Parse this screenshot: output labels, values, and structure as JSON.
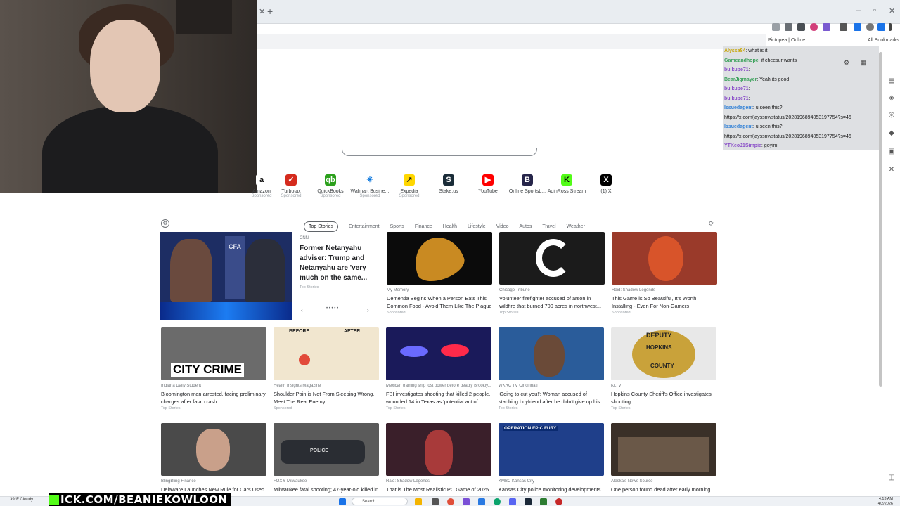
{
  "overlay": {
    "kick_url": "ICK.COM/BEANIEKOWLOON"
  },
  "chat": {
    "messages": [
      {
        "user": "Alyssa84",
        "user_color": "#c7a400",
        "text": ": what is it"
      },
      {
        "user": "Gameandhope",
        "user_color": "#3aa15a",
        "text": ": if cheesur wants"
      },
      {
        "user": "bulkupe71",
        "user_color": "#8a4fc8",
        "text": ": "
      },
      {
        "user": "BearJigmayer",
        "user_color": "#3aa15a",
        "text": ": Yeah its good"
      },
      {
        "user": "bulkupe71",
        "user_color": "#8a4fc8",
        "text": ": "
      },
      {
        "user": "bulkupe71",
        "user_color": "#8a4fc8",
        "text": ": "
      },
      {
        "user": "Issuedagent",
        "user_color": "#2f7fd6",
        "text": ": u seen this?"
      },
      {
        "user": "",
        "user_color": "#1a1a1a",
        "text": "https://x.com/jayssnv/status/2028196894053197754?s=46"
      },
      {
        "user": "Issuedagent",
        "user_color": "#2f7fd6",
        "text": ": u seen this?"
      },
      {
        "user": "",
        "user_color": "#1a1a1a",
        "text": "https://x.com/jayssnv/status/2028196894053197754?s=46"
      },
      {
        "user": "YTKeoJ1Simpie",
        "user_color": "#8a4fc8",
        "text": ": goyimi"
      }
    ]
  },
  "bookmarks": {
    "item1": "Pictopea | Online...",
    "item2": "All Bookmarks"
  },
  "shortcuts": [
    {
      "label": "Amazon",
      "sponsored": "Sponsored",
      "icon": "a",
      "color": "#111111",
      "bg": "#ffffff"
    },
    {
      "label": "Turbotax",
      "sponsored": "Sponsored",
      "icon": "✓",
      "color": "#ffffff",
      "bg": "#d52b1e"
    },
    {
      "label": "QuickBooks",
      "sponsored": "Sponsored",
      "icon": "qb",
      "color": "#ffffff",
      "bg": "#2ca01c"
    },
    {
      "label": "Walmart Busine...",
      "sponsored": "Sponsored",
      "icon": "✳",
      "color": "#0071dc",
      "bg": "#ffffff"
    },
    {
      "label": "Expedia",
      "sponsored": "Sponsored",
      "icon": "↗",
      "color": "#1a1a1a",
      "bg": "#ffd700"
    },
    {
      "label": "Stake.us",
      "sponsored": "",
      "icon": "S",
      "color": "#ffffff",
      "bg": "#1a2c38"
    },
    {
      "label": "YouTube",
      "sponsored": "",
      "icon": "▶",
      "color": "#ffffff",
      "bg": "#ff0000"
    },
    {
      "label": "Online Sportsb...",
      "sponsored": "",
      "icon": "B",
      "color": "#ffffff",
      "bg": "#26254a"
    },
    {
      "label": "AdinRoss Stream",
      "sponsored": "",
      "icon": "K",
      "color": "#000000",
      "bg": "#53fc18"
    },
    {
      "label": "(1) X",
      "sponsored": "",
      "icon": "X",
      "color": "#ffffff",
      "bg": "#000000"
    }
  ],
  "feed": {
    "tabs": [
      "Top Stories",
      "Entertainment",
      "Sports",
      "Finance",
      "Health",
      "Lifestyle",
      "Video",
      "Autos",
      "Travel",
      "Weather"
    ],
    "hero": {
      "source": "CNN",
      "title": "Former Netanyahu adviser: Trump and Netanyahu are 'very much on the same...",
      "tag": "Top Stories",
      "logo": "CFA",
      "dots": "• • • • •"
    },
    "row1": [
      {
        "source": "My Memory",
        "title": "Dementia Begins When a Person Eats This Common Food - Avoid Them Like The Plague",
        "tag": "Sponsored",
        "bg": "#0b0b0b"
      },
      {
        "source": "Chicago Tribune",
        "title": "Volunteer firefighter accused of arson in wildfire that burned 700 acres in northwest...",
        "tag": "Top Stories",
        "bg": "#1b1b1b"
      },
      {
        "source": "Raid: Shadow Legends",
        "title": "This Game is So Beautiful, It's Worth Installing - Even For Non-Gamers",
        "tag": "Sponsored",
        "bg": "#9a3a2a"
      }
    ],
    "row2": [
      {
        "source": "Indiana Daily Student",
        "title": "Bloomington man arrested, facing preliminary charges after fatal crash",
        "tag": "Top Stories",
        "bg": "#6b6b6b"
      },
      {
        "source": "Health Insights Magazine",
        "title": "Shoulder Pain is Not From Sleeping Wrong. Meet The Real Enemy",
        "tag": "Sponsored",
        "bg": "#f1e6cf"
      },
      {
        "source": "Mexican training ship lost power before deadly Brookly...",
        "title": "FBI investigates shooting that killed 2 people, wounded 14 in Texas as 'potential act of...",
        "tag": "Top Stories",
        "bg": "#1a1a5a"
      },
      {
        "source": "WKRC TV Cincinnati",
        "title": "'Going to cut you!': Woman accused of stabbing boyfriend after he didn't give up his phone",
        "tag": "Top Stories",
        "bg": "#2a5c9a"
      },
      {
        "source": "KLTV",
        "title": "Hopkins County Sheriff's Office investigates shooting",
        "tag": "Top Stories",
        "bg": "#e8e8e8"
      }
    ],
    "row3": [
      {
        "source": "BlingBling Finance",
        "title": "Delaware Launches New Rule for Cars Used",
        "tag": "",
        "bg": "#4a4a4a"
      },
      {
        "source": "FOX 6 Milwaukee",
        "title": "Milwaukee fatal shooting; 47-year-old killed in",
        "tag": "",
        "bg": "#5a5a5a"
      },
      {
        "source": "Raid: Shadow Legends",
        "title": "That is The Most Realistic PC Game of 2025",
        "tag": "",
        "bg": "#3a1f2a"
      },
      {
        "source": "KMBC Kansas City",
        "title": "Kansas City police monitoring developments",
        "tag": "",
        "bg": "#1f3f8a"
      },
      {
        "source": "Alaska's News Source",
        "title": "One person found dead after early morning",
        "tag": "",
        "bg": "#3a3028"
      }
    ],
    "images": {
      "city_crime": "CITY CRIME",
      "before": "BEFORE",
      "after": "AFTER",
      "deputy": "DEPUTY",
      "hopkins": "HOPKINS",
      "county": "COUNTY",
      "police": "POLICE",
      "operation": "OPERATION EPIC FURY"
    }
  },
  "taskbar": {
    "weather_temp": "39°F",
    "weather_desc": "Cloudy",
    "search": "Search",
    "time": "4:13 AM",
    "date": "4/2/2026"
  }
}
